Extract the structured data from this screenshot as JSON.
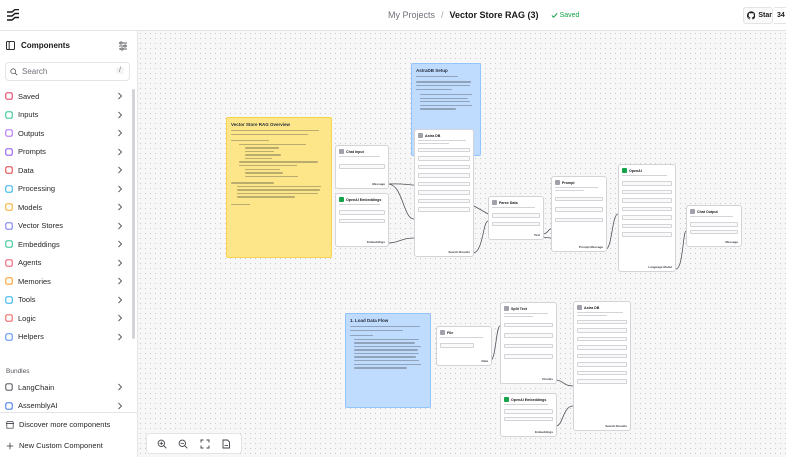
{
  "header": {
    "parent": "My Projects",
    "separator": "/",
    "title": "Vector Store RAG (3)",
    "status": "Saved",
    "star_label": "Star",
    "star_count": "34"
  },
  "sidebar": {
    "title": "Components",
    "search_placeholder": "Search",
    "search_shortcut": "/",
    "categories": [
      {
        "label": "Saved",
        "icon": "bookmark-icon"
      },
      {
        "label": "Inputs",
        "icon": "download-icon"
      },
      {
        "label": "Outputs",
        "icon": "upload-icon"
      },
      {
        "label": "Prompts",
        "icon": "terminal-icon"
      },
      {
        "label": "Data",
        "icon": "database-icon"
      },
      {
        "label": "Processing",
        "icon": "list-filter-icon"
      },
      {
        "label": "Models",
        "icon": "brain-icon"
      },
      {
        "label": "Vector Stores",
        "icon": "layers-icon"
      },
      {
        "label": "Embeddings",
        "icon": "binary-icon"
      },
      {
        "label": "Agents",
        "icon": "bot-icon"
      },
      {
        "label": "Memories",
        "icon": "cpu-icon"
      },
      {
        "label": "Tools",
        "icon": "hammer-icon"
      },
      {
        "label": "Logic",
        "icon": "git-branch-icon"
      },
      {
        "label": "Helpers",
        "icon": "wand-icon"
      }
    ],
    "bundles_label": "Bundles",
    "bundles": [
      {
        "label": "LangChain",
        "icon": "link-icon"
      },
      {
        "label": "AssemblyAI",
        "icon": "assemblyai-icon"
      }
    ],
    "discover_label": "Discover more components",
    "new_component_label": "New Custom Component"
  },
  "canvas": {
    "notes": [
      {
        "id": "overview",
        "title": "Vector Store RAG Overview",
        "color": "yellow"
      },
      {
        "id": "astra-setup",
        "title": "AstraDB Setup",
        "color": "blue"
      },
      {
        "id": "load-data",
        "title": "1. Load Data Flow",
        "color": "blue"
      }
    ],
    "nodes": [
      {
        "id": "chat-input",
        "title": "Chat Input",
        "output": "Message"
      },
      {
        "id": "openai-embeddings-1",
        "title": "OpenAI Embeddings",
        "output": "Embeddings"
      },
      {
        "id": "astra-db-1",
        "title": "Astra DB",
        "output": "Search Results"
      },
      {
        "id": "parse-data",
        "title": "Parse Data",
        "output": "Text"
      },
      {
        "id": "prompt",
        "title": "Prompt",
        "output": "Prompt Message"
      },
      {
        "id": "openai-model",
        "title": "OpenAI",
        "output": "Language Model"
      },
      {
        "id": "chat-output",
        "title": "Chat Output",
        "output": "Message"
      },
      {
        "id": "file",
        "title": "File",
        "output": "Data"
      },
      {
        "id": "split-text",
        "title": "Split Text",
        "output": "Chunks"
      },
      {
        "id": "openai-embeddings-2",
        "title": "OpenAI Embeddings",
        "output": "Embeddings"
      },
      {
        "id": "astra-db-2",
        "title": "Astra DB",
        "output": "Search Results"
      }
    ]
  },
  "toolbar": {
    "zoom_in": "zoom-in-icon",
    "zoom_out": "zoom-out-icon",
    "fit_view": "fit-view-icon",
    "lock": "lock-icon"
  },
  "colors": {
    "accent_green": "#16a34a",
    "note_yellow": "#fde68a",
    "note_blue": "#bfdbfe"
  }
}
